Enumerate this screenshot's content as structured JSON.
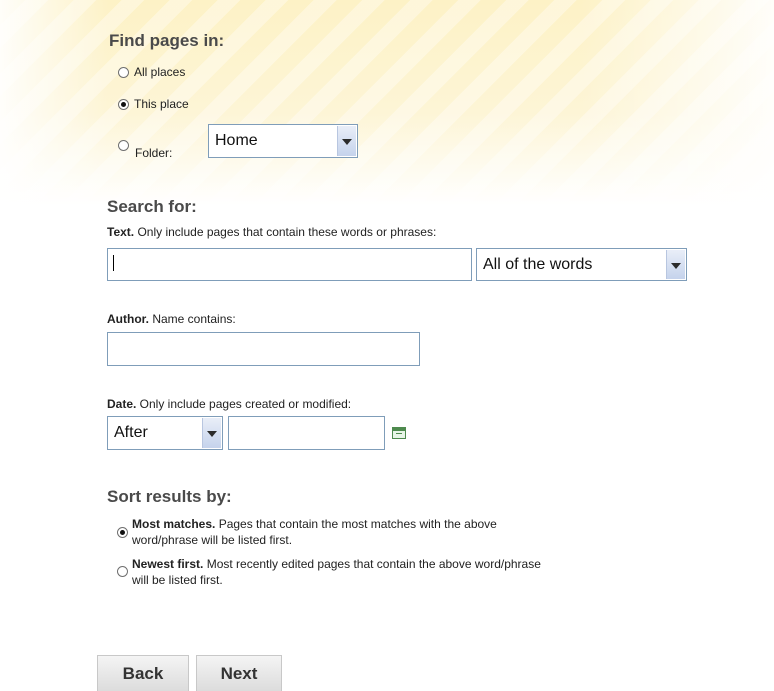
{
  "find_pages": {
    "title": "Find pages in:",
    "options": [
      {
        "label": "All places",
        "checked": false
      },
      {
        "label": "This place",
        "checked": true
      },
      {
        "label": "Folder:",
        "checked": false
      }
    ],
    "folder_select": "Home"
  },
  "search_for": {
    "title": "Search for:",
    "text_label_strong": "Text.",
    "text_label_rest": " Only include pages that contain these words or phrases:",
    "text_value": "",
    "match_select": "All of the words",
    "author_label_strong": "Author.",
    "author_label_rest": " Name contains:",
    "author_value": "",
    "date_label_strong": "Date.",
    "date_label_rest": " Only include pages created or modified:",
    "date_select": "After",
    "date_value": ""
  },
  "sort": {
    "title": "Sort results by:",
    "options": [
      {
        "label_strong": "Most matches.",
        "label_rest": " Pages that contain the most matches with the above",
        "label_line2": "word/phrase will be listed first.",
        "checked": true
      },
      {
        "label_strong": "Newest first.",
        "label_rest": " Most recently edited pages that contain the above word/phrase",
        "label_line2": "will be listed first.",
        "checked": false
      }
    ]
  },
  "buttons": {
    "back": "Back",
    "next": "Next"
  },
  "icons": {
    "calendar": "calendar-icon",
    "dropdown": "chevron-down-icon"
  }
}
